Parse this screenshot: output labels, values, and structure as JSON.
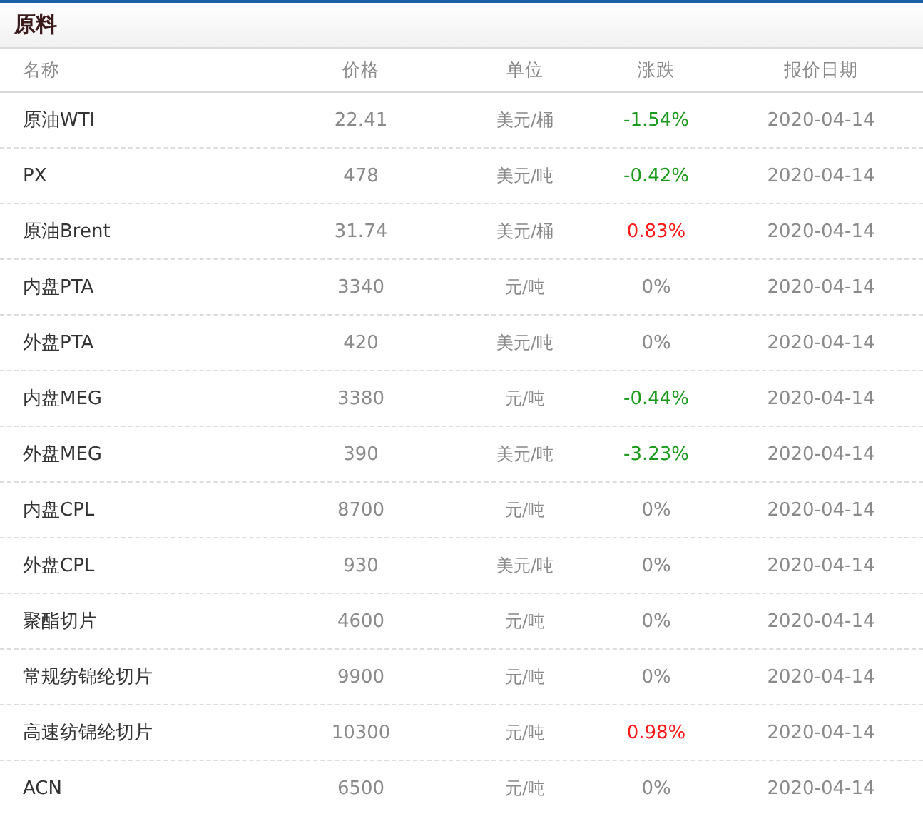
{
  "panel": {
    "title": "原料"
  },
  "table": {
    "columns": [
      "名称",
      "价格",
      "单位",
      "涨跌",
      "报价日期"
    ],
    "rows": [
      {
        "name": "原油WTI",
        "price": "22.41",
        "unit": "美元/桶",
        "change": "-1.54%",
        "color": "#1a9a1a",
        "date": "2020-04-14"
      },
      {
        "name": "PX",
        "price": "478",
        "unit": "美元/吨",
        "change": "-0.42%",
        "color": "#1a9a1a",
        "date": "2020-04-14"
      },
      {
        "name": "原油Brent",
        "price": "31.74",
        "unit": "美元/桶",
        "change": "0.83%",
        "color": "#ff1a1a",
        "date": "2020-04-14"
      },
      {
        "name": "内盘PTA",
        "price": "3340",
        "unit": "元/吨",
        "change": "0%",
        "color": "#8a8a8a",
        "date": "2020-04-14"
      },
      {
        "name": "外盘PTA",
        "price": "420",
        "unit": "美元/吨",
        "change": "0%",
        "color": "#8a8a8a",
        "date": "2020-04-14"
      },
      {
        "name": "内盘MEG",
        "price": "3380",
        "unit": "元/吨",
        "change": "-0.44%",
        "color": "#1a9a1a",
        "date": "2020-04-14"
      },
      {
        "name": "外盘MEG",
        "price": "390",
        "unit": "美元/吨",
        "change": "-3.23%",
        "color": "#1a9a1a",
        "date": "2020-04-14"
      },
      {
        "name": "内盘CPL",
        "price": "8700",
        "unit": "元/吨",
        "change": "0%",
        "color": "#8a8a8a",
        "date": "2020-04-14"
      },
      {
        "name": "外盘CPL",
        "price": "930",
        "unit": "美元/吨",
        "change": "0%",
        "color": "#8a8a8a",
        "date": "2020-04-14"
      },
      {
        "name": "聚酯切片",
        "price": "4600",
        "unit": "元/吨",
        "change": "0%",
        "color": "#8a8a8a",
        "date": "2020-04-14"
      },
      {
        "name": "常规纺锦纶切片",
        "price": "9900",
        "unit": "元/吨",
        "change": "0%",
        "color": "#8a8a8a",
        "date": "2020-04-14"
      },
      {
        "name": "高速纺锦纶切片",
        "price": "10300",
        "unit": "元/吨",
        "change": "0.98%",
        "color": "#ff1a1a",
        "date": "2020-04-14"
      },
      {
        "name": "ACN",
        "price": "6500",
        "unit": "元/吨",
        "change": "0%",
        "color": "#8a8a8a",
        "date": "2020-04-14"
      }
    ]
  }
}
